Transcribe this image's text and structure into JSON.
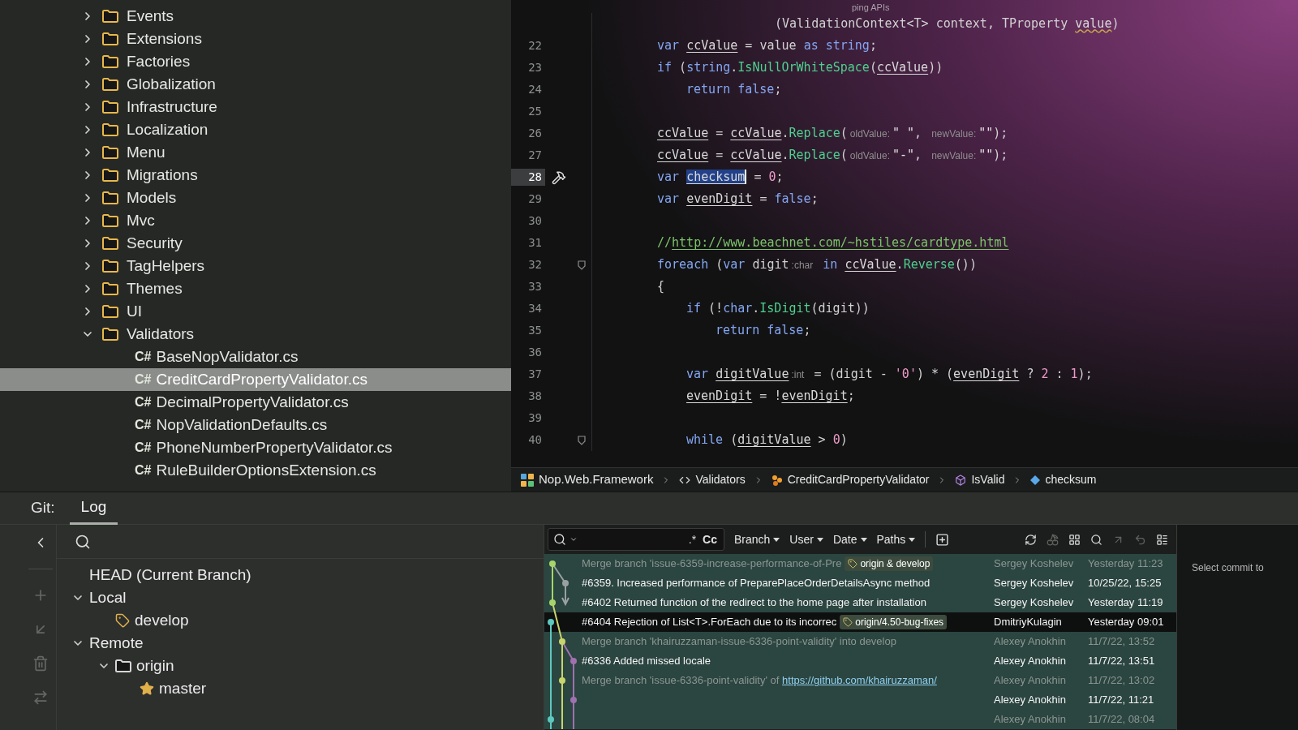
{
  "project_tree": {
    "items": [
      {
        "label": "Events",
        "kind": "folder",
        "expanded": false,
        "selected": false
      },
      {
        "label": "Extensions",
        "kind": "folder",
        "expanded": false,
        "selected": false
      },
      {
        "label": "Factories",
        "kind": "folder",
        "expanded": false,
        "selected": false
      },
      {
        "label": "Globalization",
        "kind": "folder",
        "expanded": false,
        "selected": false
      },
      {
        "label": "Infrastructure",
        "kind": "folder",
        "expanded": false,
        "selected": false
      },
      {
        "label": "Localization",
        "kind": "folder",
        "expanded": false,
        "selected": false
      },
      {
        "label": "Menu",
        "kind": "folder",
        "expanded": false,
        "selected": false
      },
      {
        "label": "Migrations",
        "kind": "folder",
        "expanded": false,
        "selected": false
      },
      {
        "label": "Models",
        "kind": "folder",
        "expanded": false,
        "selected": false
      },
      {
        "label": "Mvc",
        "kind": "folder",
        "expanded": false,
        "selected": false
      },
      {
        "label": "Security",
        "kind": "folder",
        "expanded": false,
        "selected": false
      },
      {
        "label": "TagHelpers",
        "kind": "folder",
        "expanded": false,
        "selected": false
      },
      {
        "label": "Themes",
        "kind": "folder",
        "expanded": false,
        "selected": false
      },
      {
        "label": "UI",
        "kind": "folder",
        "expanded": false,
        "selected": false
      },
      {
        "label": "Validators",
        "kind": "folder",
        "expanded": true,
        "selected": false,
        "children": [
          {
            "label": "BaseNopValidator.cs",
            "kind": "file",
            "badge": "C#",
            "selected": false
          },
          {
            "label": "CreditCardPropertyValidator.cs",
            "kind": "file",
            "badge": "C#",
            "selected": true
          },
          {
            "label": "DecimalPropertyValidator.cs",
            "kind": "file",
            "badge": "C#",
            "selected": false
          },
          {
            "label": "NopValidationDefaults.cs",
            "kind": "file",
            "badge": "C#",
            "selected": false
          },
          {
            "label": "PhoneNumberPropertyValidator.cs",
            "kind": "file",
            "badge": "C#",
            "selected": false
          },
          {
            "label": "RuleBuilderOptionsExtension.cs",
            "kind": "file",
            "badge": "C#",
            "selected": false
          }
        ]
      }
    ]
  },
  "editor": {
    "top_hint": "ping APIs",
    "lines": [
      {
        "kind": "fragment",
        "tokens": [
          {
            "kind": "plain",
            "text": "(ValidationContext<T> context, TProperty "
          },
          {
            "kind": "warn",
            "text": "value"
          },
          {
            "kind": "plain",
            "text": ")"
          }
        ]
      },
      {
        "kind": "code",
        "number": "22",
        "current": false,
        "tokens": [
          {
            "kind": "kw",
            "text": "var "
          },
          {
            "kind": "local",
            "text": "ccValue"
          },
          {
            "kind": "plain",
            "text": " = value "
          },
          {
            "kind": "kw",
            "text": "as string"
          },
          {
            "kind": "plain",
            "text": ";"
          }
        ]
      },
      {
        "kind": "code",
        "number": "23",
        "current": false,
        "tokens": [
          {
            "kind": "kw",
            "text": "if"
          },
          {
            "kind": "plain",
            "text": " ("
          },
          {
            "kind": "kw",
            "text": "string"
          },
          {
            "kind": "plain",
            "text": "."
          },
          {
            "kind": "method",
            "text": "IsNullOrWhiteSpace"
          },
          {
            "kind": "plain",
            "text": "("
          },
          {
            "kind": "local",
            "text": "ccValue"
          },
          {
            "kind": "plain",
            "text": "))"
          }
        ],
        "children": [
          {
            "kind": "code",
            "number": "24",
            "current": false,
            "tokens": [
              {
                "kind": "kw",
                "text": "return false"
              },
              {
                "kind": "plain",
                "text": ";"
              }
            ]
          }
        ]
      },
      {
        "kind": "blank",
        "number": "25",
        "current": false
      },
      {
        "kind": "code",
        "number": "26",
        "current": false,
        "tokens": [
          {
            "kind": "local",
            "text": "ccValue"
          },
          {
            "kind": "plain",
            "text": " = "
          },
          {
            "kind": "local",
            "text": "ccValue"
          },
          {
            "kind": "plain",
            "text": "."
          },
          {
            "kind": "method",
            "text": "Replace"
          },
          {
            "kind": "plain",
            "text": "("
          },
          {
            "kind": "hint",
            "text": "oldValue:"
          },
          {
            "kind": "str",
            "text": "\" \""
          },
          {
            "kind": "plain",
            "text": ", "
          },
          {
            "kind": "hint",
            "text": "newValue:"
          },
          {
            "kind": "str",
            "text": "\"\""
          },
          {
            "kind": "plain",
            "text": ");"
          }
        ]
      },
      {
        "kind": "code",
        "number": "27",
        "current": false,
        "tokens": [
          {
            "kind": "local",
            "text": "ccValue"
          },
          {
            "kind": "plain",
            "text": " = "
          },
          {
            "kind": "local",
            "text": "ccValue"
          },
          {
            "kind": "plain",
            "text": "."
          },
          {
            "kind": "method",
            "text": "Replace"
          },
          {
            "kind": "plain",
            "text": "("
          },
          {
            "kind": "hint",
            "text": "oldValue:"
          },
          {
            "kind": "str",
            "text": "\"-\""
          },
          {
            "kind": "plain",
            "text": ", "
          },
          {
            "kind": "hint",
            "text": "newValue:"
          },
          {
            "kind": "str",
            "text": "\"\""
          },
          {
            "kind": "plain",
            "text": ");"
          }
        ]
      },
      {
        "kind": "code",
        "number": "28",
        "current": true,
        "context_action": true,
        "tokens": [
          {
            "kind": "kw",
            "text": "var "
          },
          {
            "kind": "local",
            "text": "checksum",
            "highlighted": true,
            "caret": true
          },
          {
            "kind": "plain",
            "text": " = "
          },
          {
            "kind": "num",
            "text": "0"
          },
          {
            "kind": "plain",
            "text": ";"
          }
        ]
      },
      {
        "kind": "code",
        "number": "29",
        "current": false,
        "tokens": [
          {
            "kind": "kw",
            "text": "var "
          },
          {
            "kind": "local",
            "text": "evenDigit"
          },
          {
            "kind": "plain",
            "text": " = "
          },
          {
            "kind": "kw",
            "text": "false"
          },
          {
            "kind": "plain",
            "text": ";"
          }
        ]
      },
      {
        "kind": "blank",
        "number": "30",
        "current": false
      },
      {
        "kind": "code",
        "number": "31",
        "current": false,
        "tokens": [
          {
            "kind": "comment",
            "text": "//"
          },
          {
            "kind": "url",
            "text": "http://www.beachnet.com/~hstiles/cardtype.html"
          }
        ]
      },
      {
        "kind": "code",
        "number": "32",
        "current": false,
        "foldable": true,
        "tokens": [
          {
            "kind": "kw",
            "text": "foreach"
          },
          {
            "kind": "plain",
            "text": " ("
          },
          {
            "kind": "kw",
            "text": "var"
          },
          {
            "kind": "plain",
            "text": " digit"
          },
          {
            "kind": "hint",
            "text": ":char"
          },
          {
            "kind": "kw",
            "text": " in "
          },
          {
            "kind": "local",
            "text": "ccValue"
          },
          {
            "kind": "plain",
            "text": "."
          },
          {
            "kind": "method",
            "text": "Reverse"
          },
          {
            "kind": "plain",
            "text": "())"
          }
        ]
      },
      {
        "kind": "code",
        "number": "33",
        "current": false,
        "tokens": [
          {
            "kind": "plain",
            "text": "{"
          }
        ],
        "children": [
          {
            "kind": "code",
            "number": "34",
            "current": false,
            "tokens": [
              {
                "kind": "kw",
                "text": "if"
              },
              {
                "kind": "plain",
                "text": " (!"
              },
              {
                "kind": "kw",
                "text": "char"
              },
              {
                "kind": "plain",
                "text": "."
              },
              {
                "kind": "method",
                "text": "IsDigit"
              },
              {
                "kind": "plain",
                "text": "(digit))"
              }
            ],
            "children": [
              {
                "kind": "code",
                "number": "35",
                "current": false,
                "tokens": [
                  {
                    "kind": "kw",
                    "text": "return false"
                  },
                  {
                    "kind": "plain",
                    "text": ";"
                  }
                ]
              }
            ]
          },
          {
            "kind": "blank",
            "number": "36",
            "current": false
          },
          {
            "kind": "code",
            "number": "37",
            "current": false,
            "tokens": [
              {
                "kind": "kw",
                "text": "var "
              },
              {
                "kind": "local",
                "text": "digitValue"
              },
              {
                "kind": "hint",
                "text": ":int"
              },
              {
                "kind": "plain",
                "text": " = (digit - "
              },
              {
                "kind": "num",
                "text": "'0'"
              },
              {
                "kind": "plain",
                "text": ") * ("
              },
              {
                "kind": "local",
                "text": "evenDigit"
              },
              {
                "kind": "plain",
                "text": " ? "
              },
              {
                "kind": "num",
                "text": "2"
              },
              {
                "kind": "plain",
                "text": " : "
              },
              {
                "kind": "num",
                "text": "1"
              },
              {
                "kind": "plain",
                "text": ");"
              }
            ]
          },
          {
            "kind": "code",
            "number": "38",
            "current": false,
            "tokens": [
              {
                "kind": "local",
                "text": "evenDigit"
              },
              {
                "kind": "plain",
                "text": " = !"
              },
              {
                "kind": "local",
                "text": "evenDigit"
              },
              {
                "kind": "plain",
                "text": ";"
              }
            ]
          },
          {
            "kind": "blank",
            "number": "39",
            "current": false
          },
          {
            "kind": "code",
            "number": "40",
            "current": false,
            "foldable": true,
            "tokens": [
              {
                "kind": "kw",
                "text": "while"
              },
              {
                "kind": "plain",
                "text": " ("
              },
              {
                "kind": "local",
                "text": "digitValue"
              },
              {
                "kind": "plain",
                "text": " > "
              },
              {
                "kind": "num",
                "text": "0"
              },
              {
                "kind": "plain",
                "text": ")"
              }
            ]
          }
        ]
      }
    ],
    "breadcrumbs": [
      {
        "label": "Nop.Web.Framework",
        "kind": "project"
      },
      {
        "label": "Validators",
        "kind": "namespace"
      },
      {
        "label": "CreditCardPropertyValidator",
        "kind": "class"
      },
      {
        "label": "IsValid",
        "kind": "method"
      },
      {
        "label": "checksum",
        "kind": "variable"
      }
    ]
  },
  "git": {
    "title": "Git:",
    "tabs": [
      {
        "label": "Log",
        "selected": true
      }
    ],
    "side_toolbar": [
      {
        "kind": "back",
        "disabled": false
      },
      {
        "kind": "new_branch",
        "disabled": true
      },
      {
        "kind": "checkout",
        "disabled": true
      },
      {
        "kind": "delete",
        "disabled": true
      },
      {
        "kind": "compare",
        "disabled": true
      }
    ],
    "branches": [
      {
        "label": "HEAD (Current Branch)",
        "kind": "head"
      },
      {
        "label": "Local",
        "kind": "group",
        "expanded": true,
        "children": [
          {
            "label": "develop",
            "kind": "branch",
            "current": true
          }
        ]
      },
      {
        "label": "Remote",
        "kind": "group",
        "expanded": true,
        "children": [
          {
            "label": "origin",
            "kind": "folder",
            "expanded": true,
            "children": [
              {
                "label": "master",
                "kind": "branch",
                "favorite": true
              }
            ]
          }
        ]
      }
    ],
    "log": {
      "search": {
        "regex": ".*",
        "match_case": "Cc"
      },
      "filters": [
        {
          "label": "Branch"
        },
        {
          "label": "User"
        },
        {
          "label": "Date"
        },
        {
          "label": "Paths"
        }
      ],
      "actions": [
        {
          "kind": "refresh",
          "disabled": false
        },
        {
          "kind": "cherry_pick",
          "disabled": true
        },
        {
          "kind": "layout",
          "disabled": false
        },
        {
          "kind": "search",
          "disabled": false
        },
        {
          "kind": "push",
          "disabled": true
        },
        {
          "kind": "undo",
          "disabled": true
        },
        {
          "kind": "list",
          "disabled": false
        }
      ],
      "rows": [
        {
          "subject": "Merge branch 'issue-6359-increase-performance-of-Pre",
          "ref": "origin & develop",
          "author": "Sergey Koshelev",
          "date": "Yesterday 11:23",
          "dimmed": true,
          "highlighted": true
        },
        {
          "subject": "#6359. Increased performance of PreparePlaceOrderDetailsAsync method",
          "author": "Sergey Koshelev",
          "date": "10/25/22, 15:25",
          "dimmed": false,
          "highlighted": true
        },
        {
          "subject": "#6402 Returned function of the redirect to the home page after installation",
          "author": "Sergey Koshelev",
          "date": "Yesterday 11:19",
          "dimmed": false,
          "highlighted": true
        },
        {
          "subject": "#6404 Rejection of List<T>.ForEach due to its incorrec",
          "ref": "origin/4.50-bug-fixes",
          "author": "DmitriyKulagin",
          "date": "Yesterday 09:01",
          "dimmed": false,
          "highlighted": false
        },
        {
          "subject": "Merge branch 'khairuzzaman-issue-6336-point-validity' into develop",
          "author": "Alexey Anokhin",
          "date": "11/7/22, 13:52",
          "dimmed": true,
          "highlighted": true
        },
        {
          "subject": "#6336 Added missed locale",
          "author": "Alexey Anokhin",
          "date": "11/7/22, 13:51",
          "dimmed": false,
          "highlighted": true
        },
        {
          "subject": "Merge branch 'issue-6336-point-validity' of",
          "link": "https://github.com/khairuzzaman/",
          "author": "Alexey Anokhin",
          "date": "11/7/22, 13:02",
          "dimmed": true,
          "highlighted": true
        },
        {
          "author": "Alexey Anokhin",
          "date": "11/7/22, 11:21",
          "dimmed": false,
          "highlighted": true
        },
        {
          "author": "Alexey Anokhin",
          "date": "11/7/22, 08:04",
          "dimmed": true,
          "highlighted": true
        }
      ]
    },
    "details": {
      "hint": "Select commit to"
    }
  }
}
